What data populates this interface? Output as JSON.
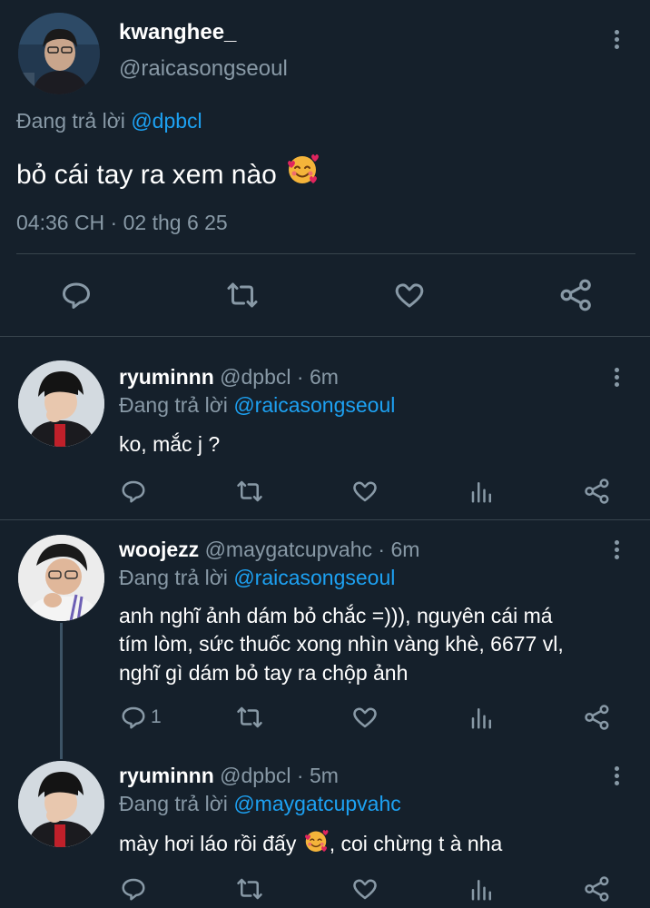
{
  "main_tweet": {
    "display_name": "kwanghee_",
    "handle": "@raicasongseoul",
    "reply_prefix": "Đang trả lời",
    "reply_to": "@dpbcl",
    "text": "bỏ cái tay ra xem nào",
    "timestamp": "04:36 CH · 02 thg 6 25"
  },
  "replies": [
    {
      "display_name": "ryuminnn",
      "handle": "@dpbcl",
      "time": "· 6m",
      "reply_prefix": "Đang trả lời",
      "reply_to": "@raicasongseoul",
      "lines": [
        "ko, mắc j ?"
      ],
      "reply_count": ""
    },
    {
      "display_name": "woojezz",
      "handle": "@maygatcupvahc",
      "time": "· 6m",
      "reply_prefix": "Đang trả lời",
      "reply_to": "@raicasongseoul",
      "lines": [
        "anh nghĩ ảnh dám bỏ chắc =))), nguyên cái má",
        "tím lòm, sức thuốc xong nhìn vàng khè, 6677 vl,",
        "nghĩ gì dám bỏ tay ra chộp ảnh"
      ],
      "reply_count": "1"
    },
    {
      "display_name": "ryuminnn",
      "handle": "@dpbcl",
      "time": "· 5m",
      "reply_prefix": "Đang trả lời",
      "reply_to": "@maygatcupvahc",
      "text_before": "mày hơi láo rồi đấy",
      "text_after": ", coi chừng t à nha",
      "reply_count": ""
    }
  ],
  "icons": [
    "reply-icon",
    "retweet-icon",
    "like-icon",
    "share-icon",
    "analytics-icon",
    "more-icon",
    "smiling-face-with-hearts-emoji"
  ],
  "colors": {
    "background": "#15202b",
    "accent": "#1da1f2",
    "muted": "#8899a6",
    "divider": "#38444d"
  }
}
